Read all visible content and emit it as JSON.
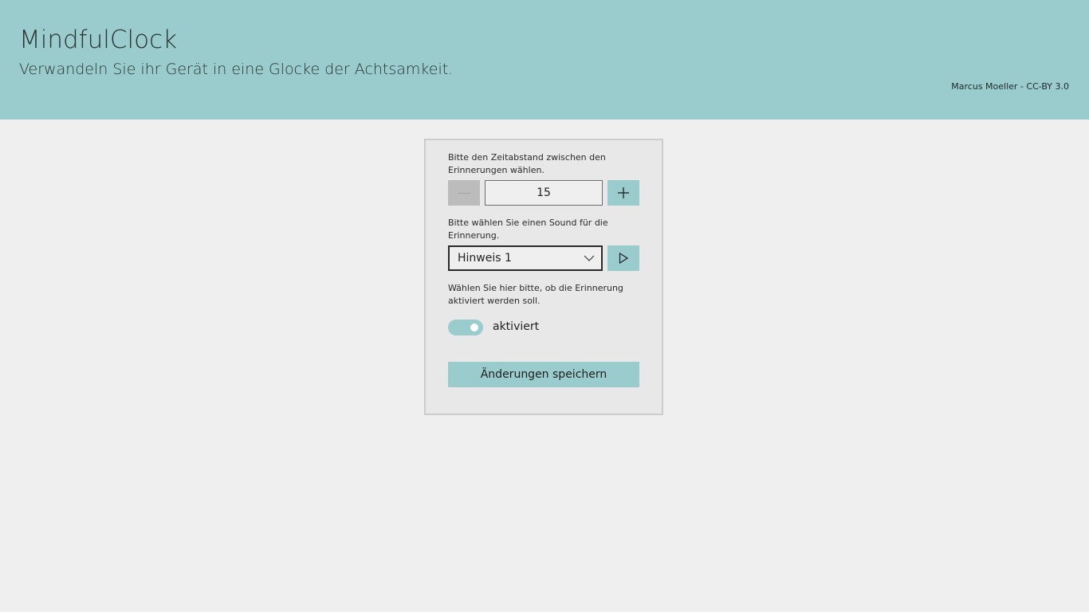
{
  "header": {
    "title": "MindfulClock",
    "subtitle": "Verwandeln Sie ihr Gerät in eine Glocke der Achtsamkeit.",
    "credit": "Marcus Moeller - CC-BY 3.0"
  },
  "interval": {
    "label": "Bitte den Zeitabstand zwischen den Erinnerungen wählen.",
    "value": "15",
    "minus_icon": "minus-icon",
    "plus_icon": "plus-icon"
  },
  "sound": {
    "label": "Bitte wählen Sie einen Sound für die Erinnerung.",
    "selected": "Hinweis 1",
    "play_icon": "play-icon"
  },
  "activation": {
    "label": "Wählen Sie hier bitte, ob die Erinnerung aktiviert werden soll.",
    "toggle_label": "aktiviert",
    "enabled": true
  },
  "save": {
    "label": "Änderungen speichern"
  },
  "colors": {
    "accent": "#9acccd",
    "background": "#efefef",
    "panel": "#e8e8e8",
    "disabled": "#bcbcbc"
  }
}
